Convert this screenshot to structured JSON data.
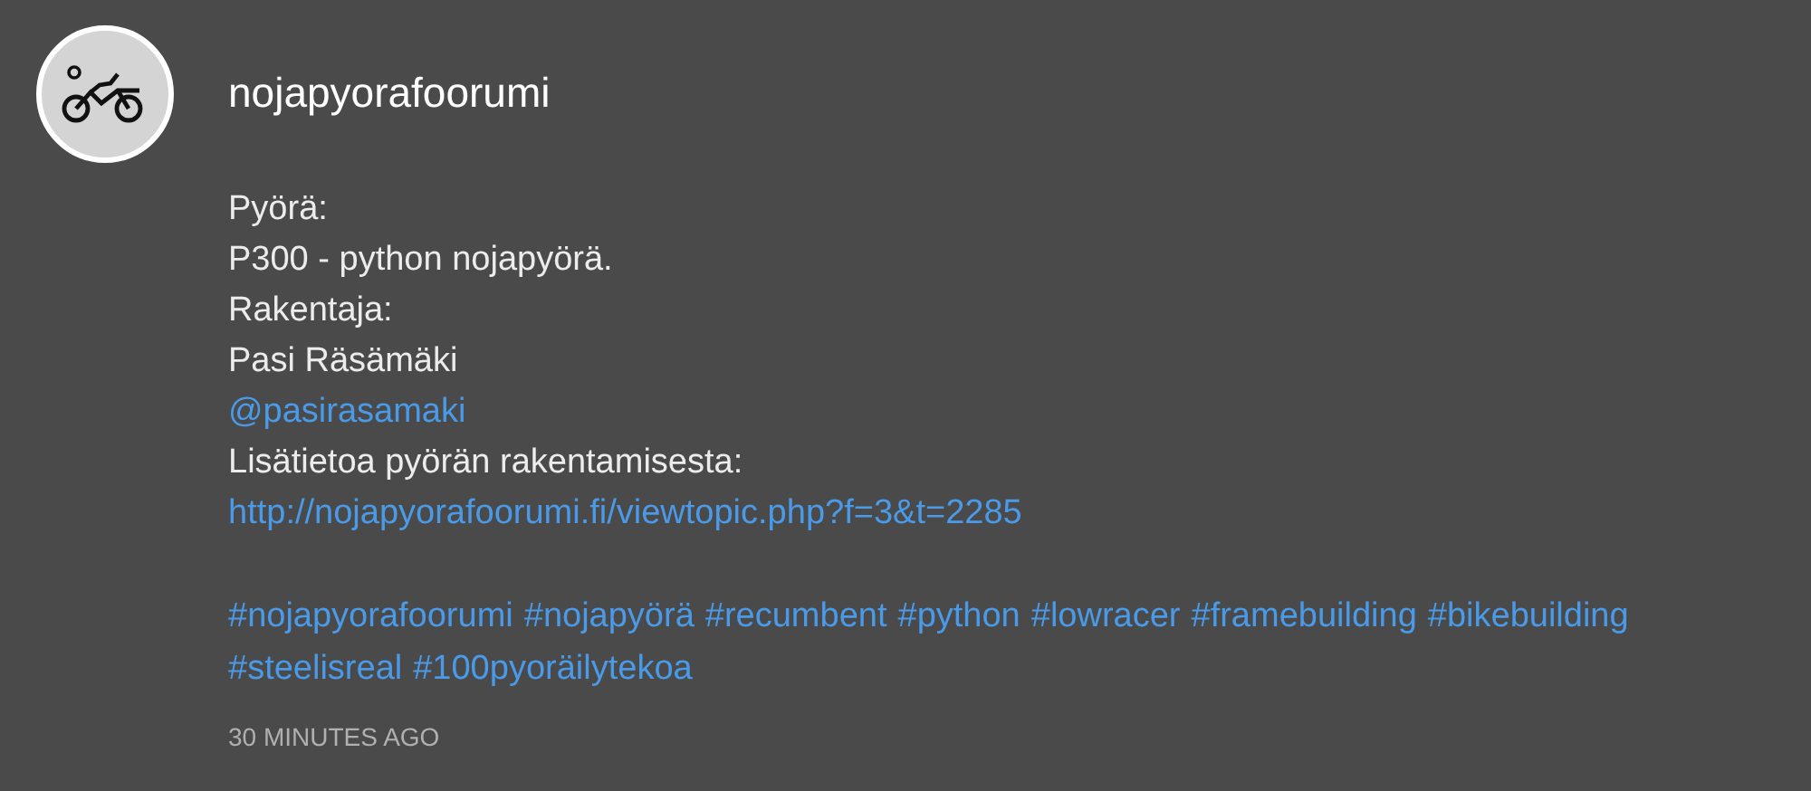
{
  "post": {
    "author": "nojapyorafoorumi",
    "lines": [
      {
        "kind": "text",
        "text": "Pyörä:"
      },
      {
        "kind": "text",
        "text": "P300 - python nojapyörä."
      },
      {
        "kind": "text",
        "text": "Rakentaja:"
      },
      {
        "kind": "text",
        "text": "Pasi Räsämäki"
      },
      {
        "kind": "link",
        "text": "@pasirasamaki"
      },
      {
        "kind": "text",
        "text": "Lisätietoa pyörän rakentamisesta:"
      },
      {
        "kind": "link",
        "text": "http://nojapyorafoorumi.fi/viewtopic.php?f=3&t=2285"
      }
    ],
    "hashtags": [
      "#nojapyorafoorumi",
      "#nojapyörä",
      "#recumbent",
      "#python",
      "#lowracer",
      "#framebuilding",
      "#bikebuilding",
      "#steelisreal",
      "#100pyoräilytekoa"
    ],
    "time": "30 MINUTES AGO"
  }
}
